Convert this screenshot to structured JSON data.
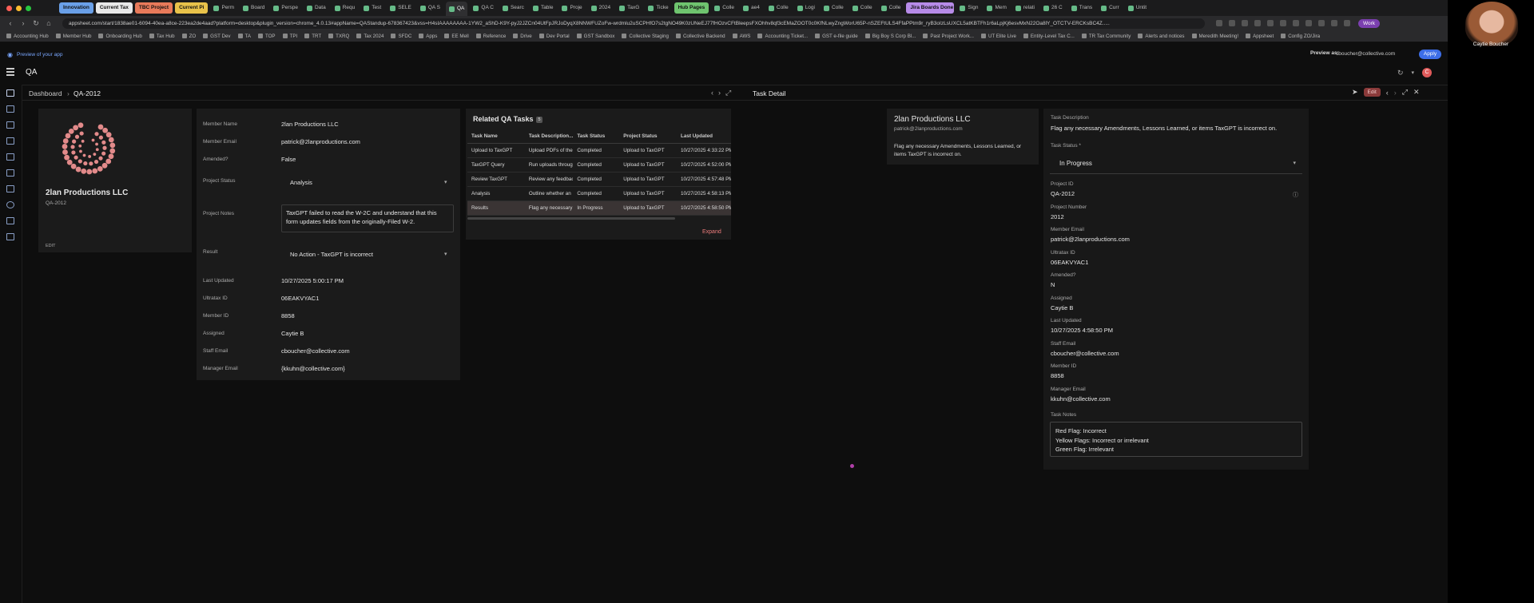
{
  "browser": {
    "tabs": [
      {
        "label": "Innovation",
        "pill": "#6aa0e8"
      },
      {
        "label": "Current Tax",
        "pill": "#e8e8e8"
      },
      {
        "label": "TBC Project",
        "pill": "#e87a5a"
      },
      {
        "label": "Current Pi",
        "pill": "#e8c24a"
      },
      {
        "label": "Perm"
      },
      {
        "label": "Board"
      },
      {
        "label": "Perspe"
      },
      {
        "label": "Data"
      },
      {
        "label": "Requ"
      },
      {
        "label": "Test"
      },
      {
        "label": "SELE"
      },
      {
        "label": "QA S"
      },
      {
        "label": "QA",
        "active": true
      },
      {
        "label": "QA C"
      },
      {
        "label": "Searc"
      },
      {
        "label": "Table"
      },
      {
        "label": "Proje"
      },
      {
        "label": "2024"
      },
      {
        "label": "TaxG"
      },
      {
        "label": "Ticke"
      },
      {
        "label": "Hub Pages",
        "pill": "#6fc46f"
      },
      {
        "label": "Colle"
      },
      {
        "label": "ae4"
      },
      {
        "label": "Colle"
      },
      {
        "label": "Logi"
      },
      {
        "label": "Colle"
      },
      {
        "label": "Colle"
      },
      {
        "label": "Colle"
      },
      {
        "label": "Jira Boards Done",
        "pill": "#b78be8"
      },
      {
        "label": "Sign"
      },
      {
        "label": "Mem"
      },
      {
        "label": "relati"
      },
      {
        "label": "26 C"
      },
      {
        "label": "Trans"
      },
      {
        "label": "Curr"
      },
      {
        "label": "Untit"
      }
    ],
    "url": "appsheet.com/start/1838ae01-6094-40ea-a8ce-223ea2de4aad?platform=desktop&plugin_version=chrome_4.0.13#appName=QAStandup-678367423&vss=H4sIAAAAAAAA-1YW2_aShD-K9Y-pyJ2JZCn04UtFpJRJoDyqX8NNWFUZoFw-wrdmlu2uSCPHfO7s2tgNO49K0zUNeEJ77fHOzvCFtBleepsFXOhhv8qf3cEMaZOOT0c0KfNLwyZngWorU65P-nSZEFtULS4FfaPPtm9r_ryB3oIzLsUXCL5atKBTFh1r6aLpjKj6esvMxN22Oa8lY_OTCTV-ERCKsBC4Z.....",
    "work_label": "Work",
    "bookmarks": [
      "Accounting Hub",
      "Member Hub",
      "Onboarding Hub",
      "Tax Hub",
      "ZO",
      "GST Dev",
      "TA",
      "TOP",
      "TPI",
      "TRT",
      "TXRQ",
      "Tax 2024",
      "SFDC",
      "Apps",
      "EE Mell",
      "Reference",
      "Drive",
      "Dev Portal",
      "GST Sandbox",
      "Collective Staging",
      "Collective Backend",
      "AWS",
      "Accounting Ticket...",
      "GST e-file guide",
      "Big Boy S Corp Bl...",
      "Past Project Work...",
      "UT Elite Live",
      "Entity-Level Tax C...",
      "TR Tax Community",
      "Alerts and notices",
      "Meredith Meeting!",
      "Appsheet",
      "Config ZO/Jira"
    ]
  },
  "preview": {
    "text": "Preview of your app",
    "as_label": "Preview as:",
    "as_value": "cboucher@collective.com",
    "apply_label": "Apply"
  },
  "app": {
    "title": "QA",
    "avatar_initial": "C"
  },
  "breadcrumb": {
    "root": "Dashboard",
    "current": "QA-2012",
    "detail_title": "Task Detail",
    "edit_label": "Edit"
  },
  "profile": {
    "company": "2lan Productions LLC",
    "project_id": "QA-2012",
    "edit_label": "EDIT",
    "logo_color": "#e28a8a"
  },
  "member": {
    "fields": [
      {
        "label": "Member Name",
        "value": "2lan Productions LLC"
      },
      {
        "label": "Member Email",
        "value": "patrick@2lanproductions.com"
      },
      {
        "label": "Amended?",
        "value": "False"
      }
    ],
    "project_status_label": "Project Status",
    "project_status_value": "Analysis",
    "project_notes_label": "Project Notes",
    "project_notes_value": "TaxGPT failed to read the W-2C and understand that this form updates fields from the originally-Filed W-2.",
    "result_label": "Result",
    "result_value": "No Action - TaxGPT is incorrect",
    "more_fields": [
      {
        "label": "Last Updated",
        "value": "10/27/2025 5:00:17 PM"
      },
      {
        "label": "Ultratax ID",
        "value": "06EAKVYAC1"
      },
      {
        "label": "Member ID",
        "value": "8858"
      },
      {
        "label": "Assigned",
        "value": "Caytie B"
      },
      {
        "label": "Staff Email",
        "value": "cboucher@collective.com"
      },
      {
        "label": "Manager Email",
        "value": "{kkuhn@collective.com}"
      }
    ]
  },
  "related": {
    "title": "Related QA Tasks",
    "count": "5",
    "columns": [
      "Task Name",
      "Task Description...",
      "Task Status",
      "Project Status",
      "Last Updated"
    ],
    "rows": [
      [
        "Upload to TaxGPT",
        "Upload PDFs of the",
        "Completed",
        "Upload to TaxGPT",
        "10/27/2025 4:33:22 PM"
      ],
      [
        "TaxGPT Query",
        "Run uploads throug",
        "Completed",
        "Upload to TaxGPT",
        "10/27/2025 4:52:00 PM"
      ],
      [
        "Review TaxGPT",
        "Review any feedbac",
        "Completed",
        "Upload to TaxGPT",
        "10/27/2025 4:57:48 PM"
      ],
      [
        "Analysis",
        "Outline whether an",
        "Completed",
        "Upload to TaxGPT",
        "10/27/2025 4:58:13 PM"
      ],
      [
        "Results",
        "Flag any necessary",
        "In Progress",
        "Upload to TaxGPT",
        "10/27/2025 4:58:50 PM"
      ]
    ],
    "expand_label": "Expand"
  },
  "summary": {
    "company": "2lan Productions LLC",
    "email": "patrick@2lanproductions.com",
    "description": "Flag any necessary Amendments, Lessons Learned, or items TaxGPT is incorrect on."
  },
  "detail": {
    "task_description_label": "Task Description",
    "task_description_value": "Flag any necessary Amendments, Lessons Learned, or items TaxGPT is incorrect on.",
    "task_status_label": "Task Status *",
    "task_status_value": "In Progress",
    "fields": [
      {
        "label": "Project ID",
        "value": "QA-2012"
      },
      {
        "label": "Project Number",
        "value": "2012"
      },
      {
        "label": "Member Email",
        "value": "patrick@2lanproductions.com"
      },
      {
        "label": "Ultratax ID",
        "value": "06EAKVYAC1"
      },
      {
        "label": "Amended?",
        "value": "N"
      },
      {
        "label": "Assigned",
        "value": "Caytie B"
      },
      {
        "label": "Last Updated",
        "value": "10/27/2025 4:58:50 PM"
      },
      {
        "label": "Staff Email",
        "value": "cboucher@collective.com"
      },
      {
        "label": "Member ID",
        "value": "8858"
      },
      {
        "label": "Manager Email",
        "value": "kkuhn@collective.com"
      }
    ],
    "task_notes_label": "Task Notes",
    "task_notes": [
      "Red Flag: Incorrect",
      "Yellow Flags: Incorrect or irrelevant",
      "Green Flag: Irrelevant"
    ]
  },
  "webcam": {
    "name": "Caytie Boucher"
  }
}
